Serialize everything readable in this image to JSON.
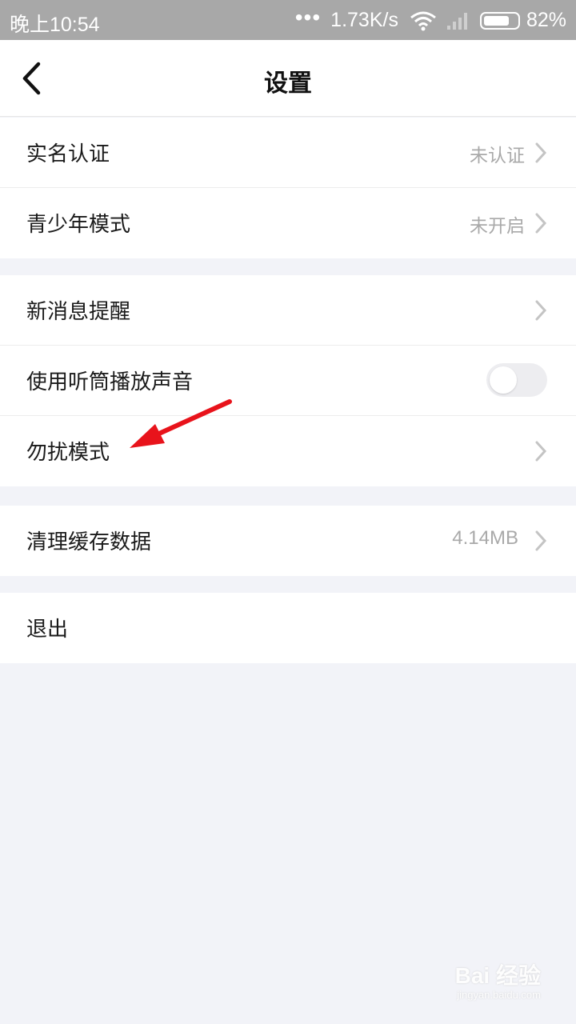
{
  "status_bar": {
    "time": "晚上10:54",
    "dots": "•••",
    "speed": "1.73K/s",
    "battery": "82%",
    "battery_level": 0.82,
    "icons": [
      "wifi-icon",
      "signal-icon",
      "battery-icon"
    ]
  },
  "header": {
    "title": "设置",
    "back_icon": "chevron-left-icon"
  },
  "groups": [
    {
      "items": [
        {
          "label": "实名认证",
          "value": "未认证"
        },
        {
          "label": "青少年模式",
          "value": "未开启"
        }
      ]
    },
    {
      "items": [
        {
          "label": "新消息提醒"
        },
        {
          "label": "使用听筒播放声音",
          "toggle_on": false
        },
        {
          "label": "勿扰模式"
        }
      ]
    },
    {
      "items": [
        {
          "label": "清理缓存数据",
          "value": "4.14MB"
        }
      ]
    },
    {
      "items": [
        {
          "label": "退出"
        }
      ]
    }
  ],
  "watermark": {
    "text": "Bai 经验",
    "subtext": "jingyan.baidu.com"
  },
  "colors": {
    "status_bar_bg": "#a8a8a8",
    "page_bg": "#f2f3f8",
    "secondary_text": "#a9a9a9",
    "annotation_arrow": "#e8131b",
    "toggle_off": "#ededf0"
  }
}
